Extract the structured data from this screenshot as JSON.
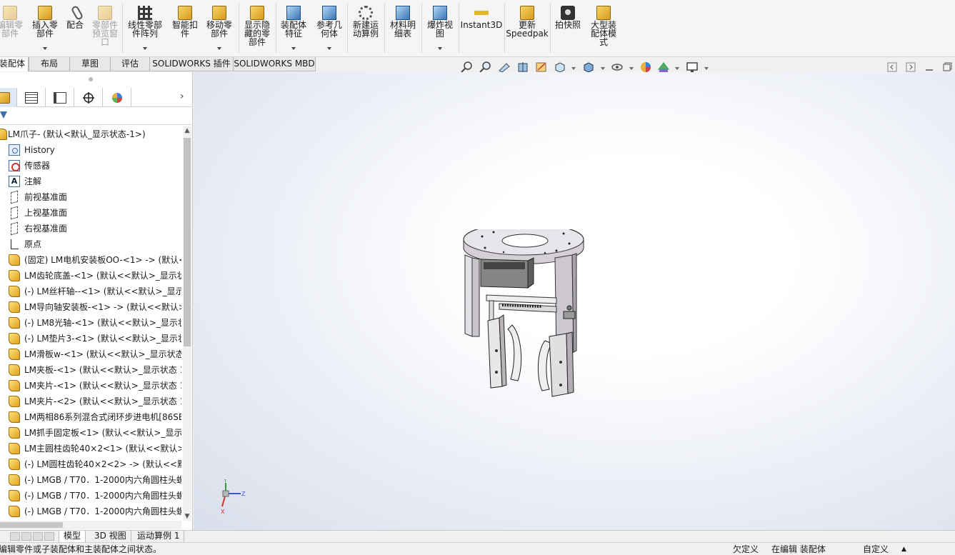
{
  "ribbon": {
    "buttons": [
      {
        "label": "编辑零\n部件",
        "icon": "edit-component-icon",
        "enabled": false
      },
      {
        "label": "插入零\n部件",
        "icon": "insert-component-icon",
        "enabled": true,
        "dropdown": true
      },
      {
        "label": "配合",
        "icon": "mate-icon",
        "enabled": true
      },
      {
        "label": "零部件\n预览窗\n口",
        "icon": "component-preview-icon",
        "enabled": false
      },
      {
        "label": "线性零部\n件阵列",
        "icon": "linear-pattern-icon",
        "enabled": true,
        "dropdown": true
      },
      {
        "label": "智能扣\n件",
        "icon": "smart-fasteners-icon",
        "enabled": true
      },
      {
        "label": "移动零\n部件",
        "icon": "move-component-icon",
        "enabled": true,
        "dropdown": true
      },
      {
        "label": "显示隐\n藏的零\n部件",
        "icon": "show-hidden-components-icon",
        "enabled": true
      },
      {
        "label": "装配体\n特征",
        "icon": "assembly-features-icon",
        "enabled": true,
        "dropdown": true
      },
      {
        "label": "参考几\n何体",
        "icon": "reference-geometry-icon",
        "enabled": true,
        "dropdown": true
      },
      {
        "label": "新建运\n动算例",
        "icon": "new-motion-study-icon",
        "enabled": true
      },
      {
        "label": "材料明\n细表",
        "icon": "bill-of-materials-icon",
        "enabled": true
      },
      {
        "label": "爆炸视\n图",
        "icon": "exploded-view-icon",
        "enabled": true,
        "dropdown": true
      },
      {
        "label": "Instant3D",
        "icon": "instant3d-icon",
        "enabled": true
      },
      {
        "label": "更新\nSpeedpak",
        "icon": "update-speedpak-icon",
        "enabled": true
      },
      {
        "label": "拍快照",
        "icon": "take-snapshot-icon",
        "enabled": true
      },
      {
        "label": "大型装\n配体模\n式",
        "icon": "large-assembly-mode-icon",
        "enabled": true
      }
    ]
  },
  "command_tabs": [
    "装配体",
    "布局",
    "草图",
    "评估",
    "SOLIDWORKS 插件",
    "SOLIDWORKS MBD"
  ],
  "active_command_tab": "装配体",
  "view_toolbar": [
    "zoom-to-fit-icon",
    "zoom-to-area-icon",
    "previous-view-icon",
    "section-view-icon",
    "dynamic-annotation-icon",
    "view-orientation-icon",
    "display-style-icon",
    "hide-show-items-icon",
    "edit-appearance-icon",
    "apply-scene-icon",
    "view-settings-icon"
  ],
  "feature_manager": {
    "panel_tabs": [
      "featuremanager-icon",
      "propertymanager-icon",
      "configurationmanager-icon",
      "dimxpertmanager-icon",
      "displaymanager-icon"
    ],
    "root": "LM爪子-  (默认<默认_显示状态-1>)",
    "items": [
      {
        "icon": "history-icon",
        "label": "History"
      },
      {
        "icon": "sensors-icon",
        "label": "传感器"
      },
      {
        "icon": "annotations-icon",
        "label": "注解"
      },
      {
        "icon": "plane-icon",
        "label": "前视基准面"
      },
      {
        "icon": "plane-icon",
        "label": "上视基准面"
      },
      {
        "icon": "plane-icon",
        "label": "右视基准面"
      },
      {
        "icon": "origin-icon",
        "label": "原点"
      },
      {
        "icon": "part-icon",
        "label": "(固定) LM电机安装板OO-<1> -> (默认<"
      },
      {
        "icon": "part-icon",
        "label": "LM齿轮底盖-<1> (默认<<默认>_显示状"
      },
      {
        "icon": "part-icon",
        "label": "(-) LM丝杆轴--<1> (默认<<默认>_显示:"
      },
      {
        "icon": "part-icon",
        "label": "LM导向轴安装板-<1> -> (默认<<默认>_"
      },
      {
        "icon": "part-icon",
        "label": "(-) LM8光轴-<1> (默认<<默认>_显示状"
      },
      {
        "icon": "part-icon",
        "label": "(-) LM垫片3-<1> (默认<<默认>_显示状"
      },
      {
        "icon": "part-icon",
        "label": "LM滑板w-<1> (默认<<默认>_显示状态"
      },
      {
        "icon": "part-icon",
        "label": "LM夹板-<1> (默认<<默认>_显示状态 1"
      },
      {
        "icon": "part-icon",
        "label": "LM夹片-<1> (默认<<默认>_显示状态 1"
      },
      {
        "icon": "part-icon",
        "label": "LM夹片-<2> (默认<<默认>_显示状态 1"
      },
      {
        "icon": "part-icon",
        "label": "LM两相86系列混合式闭环步进电机[86SB"
      },
      {
        "icon": "part-icon",
        "label": "LM抓手固定板<1> (默认<<默认>_显示ҳ"
      },
      {
        "icon": "part-icon",
        "label": "LM主圆柱齿轮40×2<1> (默认<<默认>_"
      },
      {
        "icon": "part-icon",
        "label": "(-) LM圆柱齿轮40×2<2> -> (默认<<默i"
      },
      {
        "icon": "part-icon",
        "label": "(-) LMGB / T70．1-2000内六角圆柱头螺"
      },
      {
        "icon": "part-icon",
        "label": "(-) LMGB / T70．1-2000内六角圆柱头螺"
      },
      {
        "icon": "part-icon",
        "label": "(-) LMGB / T70．1-2000内六角圆柱头螺"
      }
    ]
  },
  "triad": {
    "y": "Y",
    "z": "Z",
    "x": "X"
  },
  "bottom_tabs": [
    "模型",
    "3D 视图",
    "运动算例 1"
  ],
  "active_bottom_tab": "模型",
  "status": {
    "message": "编辑零件或子装配体和主装配体之间状态。",
    "definition": "欠定义",
    "editing": "在编辑 装配体",
    "units": "自定义"
  }
}
